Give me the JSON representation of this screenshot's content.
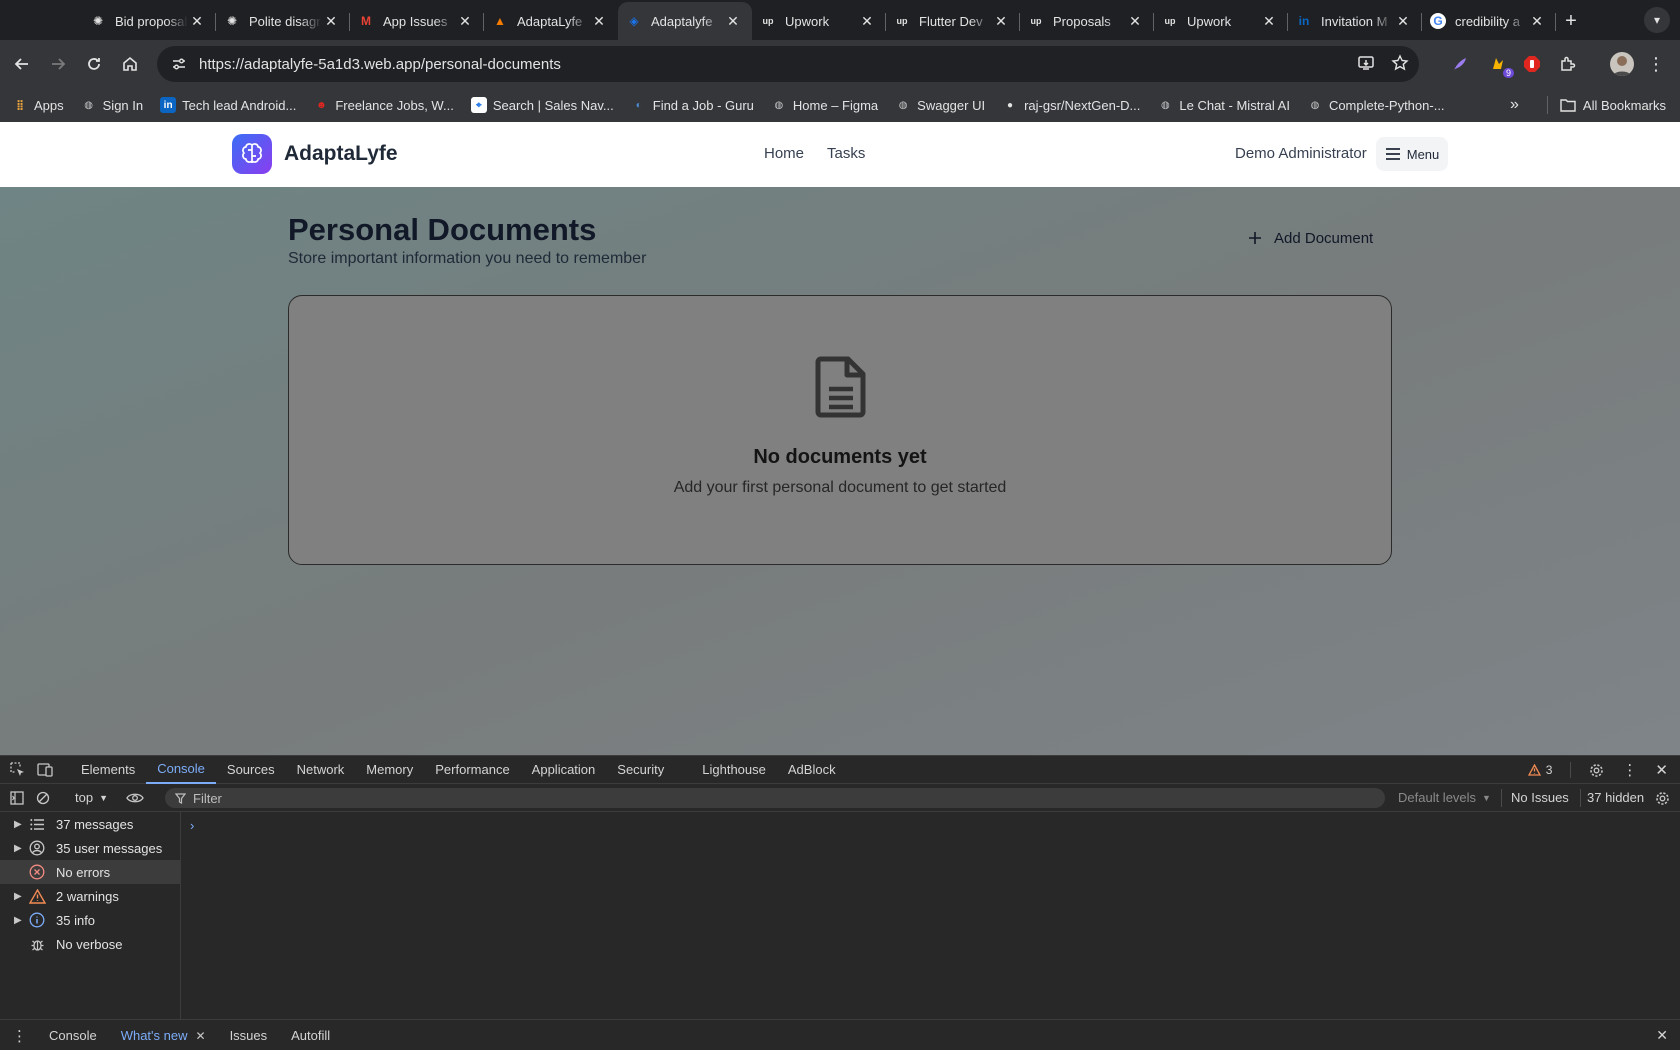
{
  "browser": {
    "tabs": [
      {
        "title": "Bid proposal",
        "icon": "openai-icon",
        "color": "#2b2b2b",
        "active": false
      },
      {
        "title": "Polite disagreement",
        "icon": "openai-icon",
        "color": "#2b2b2b",
        "active": false
      },
      {
        "title": "App Issues",
        "icon": "gmail-icon",
        "color": "#ea4335",
        "active": false
      },
      {
        "title": "AdaptaLyfe",
        "icon": "firebase-icon",
        "color": "#f57c00",
        "active": false
      },
      {
        "title": "Adaptalyfe",
        "icon": "app-icon",
        "color": "#1a73e8",
        "active": true
      },
      {
        "title": "Upwork",
        "icon": "upwork-icon",
        "color": "#14a800",
        "active": false
      },
      {
        "title": "Flutter Dev",
        "icon": "upwork-icon",
        "color": "#14a800",
        "active": false
      },
      {
        "title": "Proposals",
        "icon": "upwork-icon",
        "color": "#14a800",
        "active": false
      },
      {
        "title": "Upwork",
        "icon": "upwork-icon",
        "color": "#14a800",
        "active": false
      },
      {
        "title": "Invitation M",
        "icon": "linkedin-icon",
        "color": "#0a66c2",
        "active": false
      },
      {
        "title": "credibility a",
        "icon": "google-icon",
        "color": "#4285f4",
        "active": false
      }
    ],
    "url": "https://adaptalyfe-5a1d3.web.app/personal-documents",
    "extension_badge": "9",
    "bookmarks": [
      {
        "label": "Apps",
        "icon": "apps-grid-icon"
      },
      {
        "label": "Sign In",
        "icon": "globe-icon"
      },
      {
        "label": "Tech lead Android...",
        "icon": "linkedin-icon"
      },
      {
        "label": "Freelance Jobs, W...",
        "icon": "freelancer-icon"
      },
      {
        "label": "Search | Sales Nav...",
        "icon": "compass-icon"
      },
      {
        "label": "Find a Job - Guru",
        "icon": "guru-icon"
      },
      {
        "label": "Home – Figma",
        "icon": "globe-icon"
      },
      {
        "label": "Swagger UI",
        "icon": "globe-icon"
      },
      {
        "label": "raj-gsr/NextGen-D...",
        "icon": "github-icon"
      },
      {
        "label": "Le Chat - Mistral AI",
        "icon": "globe-icon"
      },
      {
        "label": "Complete-Python-...",
        "icon": "globe-icon"
      }
    ],
    "all_bookmarks_label": "All Bookmarks"
  },
  "app": {
    "brand": "AdaptaLyfe",
    "nav": [
      "Home",
      "Tasks"
    ],
    "user": "Demo Administrator",
    "menu_label": "Menu",
    "page_title": "Personal Documents",
    "page_subtitle": "Store important information you need to remember",
    "add_button": "Add Document",
    "empty_title": "No documents yet",
    "empty_subtitle": "Add your first personal document to get started"
  },
  "devtools": {
    "tabs": [
      "Elements",
      "Console",
      "Sources",
      "Network",
      "Memory",
      "Performance",
      "Application",
      "Security",
      "Lighthouse",
      "AdBlock"
    ],
    "active_tab": "Console",
    "warning_count": "3",
    "context": "top",
    "filter_placeholder": "Filter",
    "levels": "Default levels",
    "issues": "No Issues",
    "hidden": "37 hidden",
    "sidebar": [
      {
        "label": "37 messages",
        "icon": "list-icon",
        "expandable": true
      },
      {
        "label": "35 user messages",
        "icon": "user-circle-icon",
        "expandable": true
      },
      {
        "label": "No errors",
        "icon": "error-icon",
        "expandable": false
      },
      {
        "label": "2 warnings",
        "icon": "warning-icon",
        "expandable": true
      },
      {
        "label": "35 info",
        "icon": "info-icon",
        "expandable": true
      },
      {
        "label": "No verbose",
        "icon": "bug-icon",
        "expandable": false
      }
    ],
    "drawer_tabs": [
      "Console",
      "What's new",
      "Issues",
      "Autofill"
    ],
    "drawer_active": "What's new"
  }
}
